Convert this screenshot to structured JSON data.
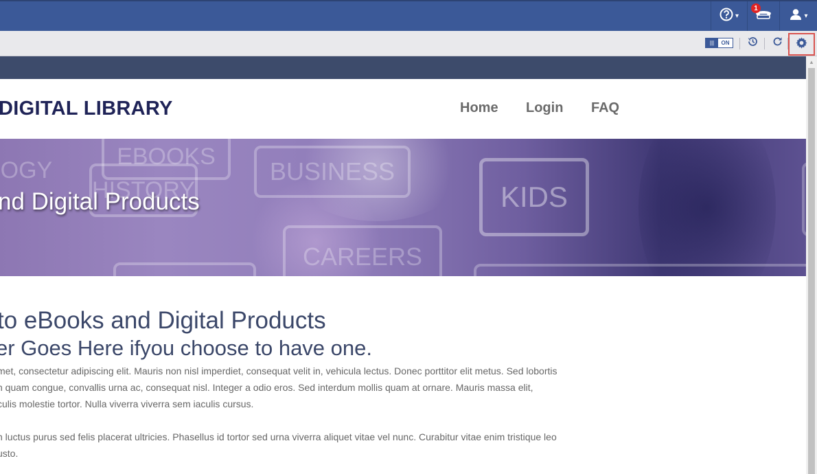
{
  "topbar": {
    "help_icon": "question-circle-icon",
    "notifications": {
      "icon": "phone-icon",
      "badge": "1"
    },
    "user_icon": "user-icon"
  },
  "toolbar": {
    "toggle_state": "ON",
    "history_icon": "history-icon",
    "refresh_icon": "refresh-icon",
    "settings_icon": "gear-icon",
    "highlight_color": "#d9534f"
  },
  "site": {
    "title": "DIGITAL LIBRARY",
    "nav": [
      "Home",
      "Login",
      "FAQ"
    ]
  },
  "banner": {
    "title": "nd Digital Products",
    "tags": [
      "EBOOKS",
      "LOGY",
      "HISTORY",
      "BUSINESS",
      "KIDS",
      "CAREERS"
    ]
  },
  "content": {
    "heading": " to eBooks and Digital Products",
    "subheading": "er Goes Here ifyou choose to have one.",
    "paragraph1": [
      "met, consectetur adipiscing elit. Mauris non nisl imperdiet, consequat velit in, vehicula lectus. Donec porttitor elit metus. Sed lobortis",
      "n quam congue, convallis urna ac, consequat nisl. Integer a odio eros. Sed interdum mollis quam at ornare. Mauris massa elit,",
      "culis molestie tortor. Nulla viverra viverra sem iaculis cursus."
    ],
    "paragraph2": [
      "n luctus purus sed felis placerat ultricies. Phasellus id tortor sed urna viverra aliquet vitae vel nunc. Curabitur vitae enim tristique leo",
      "usto."
    ]
  },
  "colors": {
    "brand_blue": "#3b5998",
    "nav_strip": "#3d4b6b",
    "title_navy": "#1f2357",
    "heading": "#3b4769"
  }
}
